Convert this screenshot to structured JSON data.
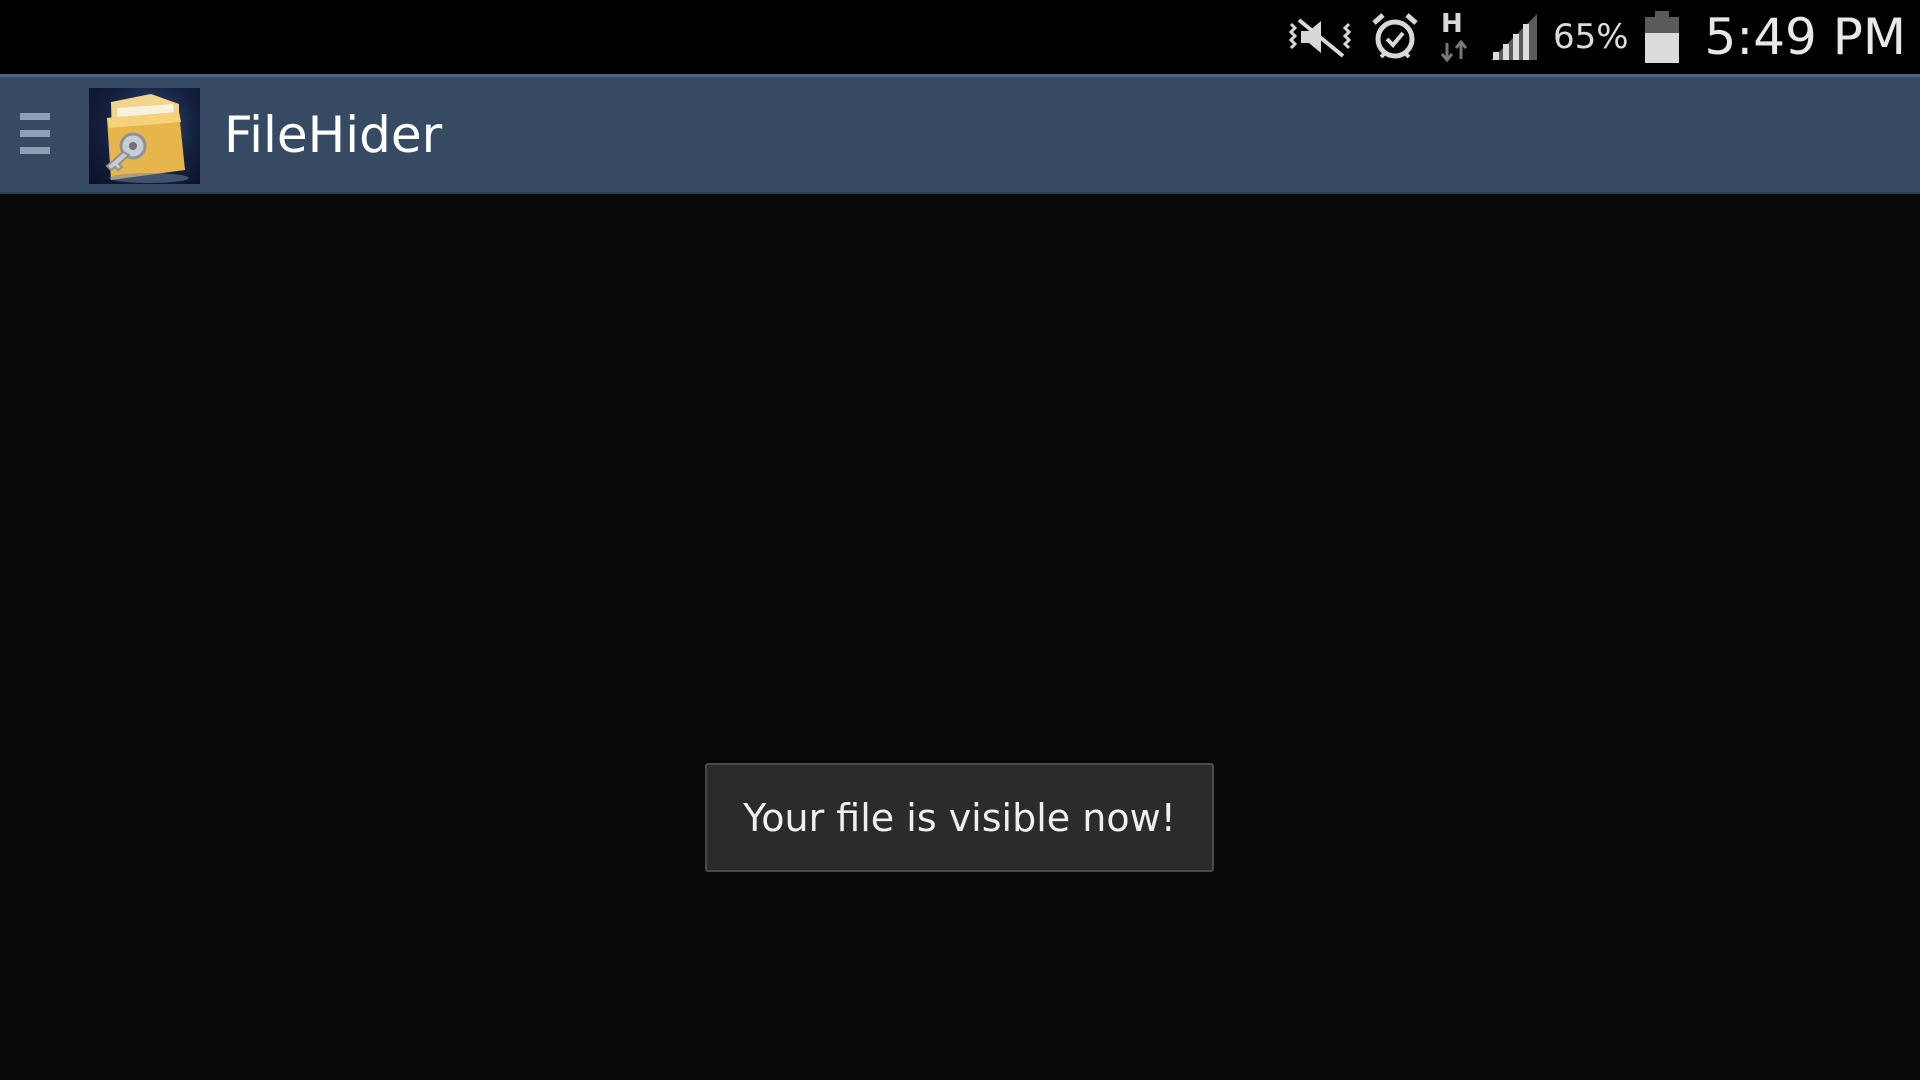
{
  "status_bar": {
    "icons": [
      "vibrate-mute-icon",
      "alarm-icon",
      "hspa-data-icon",
      "signal-icon",
      "battery-icon"
    ],
    "network_type": "H",
    "battery_percent": "65%",
    "battery_level": 0.65,
    "time": "5:49 PM"
  },
  "action_bar": {
    "title": "FileHider",
    "menu_icon": "drawer-menu-icon",
    "app_icon": "folder-key-icon",
    "background_color": "#364b63"
  },
  "toast": {
    "message": "Your file is visible now!"
  },
  "colors": {
    "background": "#080808",
    "status_bar": "#000000",
    "toast_bg": "#2b2b2b"
  }
}
